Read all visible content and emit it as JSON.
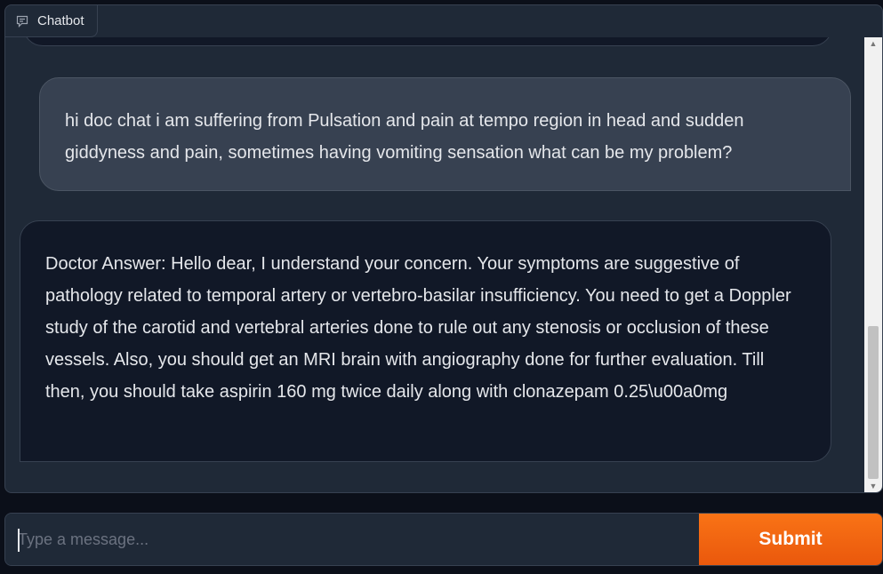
{
  "chatbot": {
    "label": "Chatbot",
    "icon": "chat-icon",
    "messages": [
      {
        "role": "user",
        "text": "hi doc chat i am suffering from Pulsation and pain at tempo region in head and sudden giddyness and pain, sometimes having vomiting sensation what can be my problem?"
      },
      {
        "role": "bot",
        "text": "Doctor Answer: Hello dear, I understand your concern. Your symptoms are suggestive of pathology related to temporal artery or vertebro-basilar insufficiency. You need to get a Doppler study of the carotid and vertebral arteries done to rule out any stenosis or occlusion of these vessels. Also, you should get an MRI brain with angiography done for further evaluation. Till then, you should take aspirin 160 mg twice daily along with clonazepam 0.25\\u00a0mg"
      }
    ]
  },
  "input": {
    "value": "",
    "placeholder": "Type a message..."
  },
  "submit": {
    "label": "Submit"
  },
  "colors": {
    "accent": "#f97316",
    "panel": "#1f2937",
    "background": "#0b0f19"
  }
}
